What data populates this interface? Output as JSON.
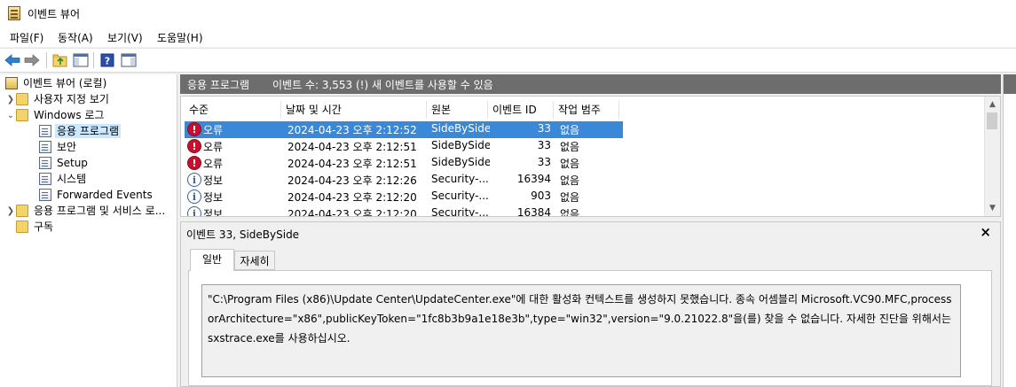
{
  "window": {
    "title": "이벤트 뷰어"
  },
  "menu": [
    "파일(F)",
    "동작(A)",
    "보기(V)",
    "도움말(H)"
  ],
  "toolbar": {
    "icons": [
      "back-arrow-icon",
      "forward-arrow-icon",
      "up-folder-icon",
      "show-hide-console-tree-icon",
      "help-icon",
      "show-hide-action-pane-icon"
    ]
  },
  "tree": {
    "root": "이벤트 뷰어 (로컬)",
    "custom_views": "사용자 지정 보기",
    "windows_logs": "Windows 로그",
    "application": "응용 프로그램",
    "security": "보안",
    "setup": "Setup",
    "system": "시스템",
    "forwarded": "Forwarded Events",
    "apps_services": "응용 프로그램 및 서비스 로...",
    "subscriptions": "구독"
  },
  "log_header": {
    "name": "응용 프로그램",
    "count": "이벤트 수: 3,553 (!) 새 이벤트를 사용할 수 있음"
  },
  "columns": [
    "수준",
    "날짜 및 시간",
    "원본",
    "이벤트 ID",
    "작업 범주"
  ],
  "events": [
    {
      "level": "오류",
      "type": "error",
      "date": "2024-04-23 오후 2:12:52",
      "source": "SideBySide",
      "id": "33",
      "category": "없음"
    },
    {
      "level": "오류",
      "type": "error",
      "date": "2024-04-23 오후 2:12:51",
      "source": "SideBySide",
      "id": "33",
      "category": "없음"
    },
    {
      "level": "오류",
      "type": "error",
      "date": "2024-04-23 오후 2:12:51",
      "source": "SideBySide",
      "id": "33",
      "category": "없음"
    },
    {
      "level": "정보",
      "type": "info",
      "date": "2024-04-23 오후 2:12:26",
      "source": "Security-...",
      "id": "16394",
      "category": "없음"
    },
    {
      "level": "정보",
      "type": "info",
      "date": "2024-04-23 오후 2:12:20",
      "source": "Security-...",
      "id": "903",
      "category": "없음"
    },
    {
      "level": "정보",
      "type": "info",
      "date": "2024-04-23 오후 2:12:20",
      "source": "Security-...",
      "id": "16384",
      "category": "없음"
    }
  ],
  "detail": {
    "title": "이벤트 33, SideBySide",
    "close": "×",
    "tabs": [
      "일반",
      "자세히"
    ],
    "description": "\"C:\\Program Files (x86)\\Update Center\\UpdateCenter.exe\"에 대한 활성화 컨텍스트를 생성하지 못했습니다. 종속 어셈블리 Microsoft.VC90.MFC,processorArchitecture=\"x86\",publicKeyToken=\"1fc8b3b9a1e18e3b\",type=\"win32\",version=\"9.0.21022.8\"을(를) 찾을 수 없습니다. 자세한 진단을 위해서는 sxstrace.exe를 사용하십시오."
  },
  "colors": {
    "selection": "#3a88d8",
    "header_bar": "#6d6d6d",
    "error": "#c8102e",
    "info": "#3b5f93"
  }
}
